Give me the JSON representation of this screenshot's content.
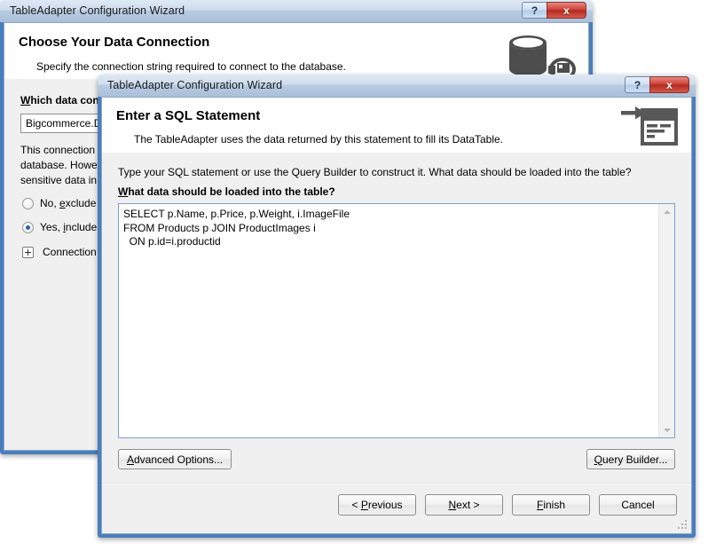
{
  "background_window": {
    "title": "TableAdapter Configuration Wizard",
    "help_button": "?",
    "close_button": "x",
    "heading": "Choose Your Data Connection",
    "subheading": "Specify the connection string required to connect to the database.",
    "icon": "database-icon",
    "connection_label_prefix": "W",
    "connection_label": "hich data conn",
    "connection_value": "Bigcommerce.D",
    "description_lines": [
      "This connection",
      "database. Howev",
      "sensitive data in"
    ],
    "radio_no": {
      "prefix": "No, ",
      "mnemonic": "e",
      "suffix": "xclude s",
      "checked": false
    },
    "radio_yes": {
      "prefix": "Yes, ",
      "mnemonic": "i",
      "suffix": "nclude s",
      "checked": true
    },
    "expander_label": "Connection",
    "expander_state": "+"
  },
  "foreground_window": {
    "title": "TableAdapter Configuration Wizard",
    "help_button": "?",
    "close_button": "x",
    "heading": "Enter a SQL Statement",
    "subheading": "The TableAdapter uses the data returned by this statement to fill its DataTable.",
    "icon": "sql-statement-icon",
    "instruction": "Type your SQL statement or use the Query Builder to construct it. What data should be loaded into the table?",
    "prompt_mnemonic": "W",
    "prompt_rest": "hat data should be loaded into the table?",
    "sql_value": "SELECT p.Name, p.Price, p.Weight, i.ImageFile\nFROM Products p JOIN ProductImages i\n  ON p.id=i.productid",
    "scrollbar": {
      "up_arrow": "scroll-up-icon",
      "down_arrow": "scroll-down-icon"
    },
    "advanced_options": {
      "mnemonic": "A",
      "rest": "dvanced Options..."
    },
    "query_builder": {
      "mnemonic": "Q",
      "rest": "uery Builder..."
    },
    "footer_buttons": [
      {
        "name": "previous",
        "prefix": "< ",
        "mnemonic": "P",
        "rest": "revious"
      },
      {
        "name": "next",
        "prefix": "",
        "mnemonic": "N",
        "rest": "ext >"
      },
      {
        "name": "finish",
        "prefix": "",
        "mnemonic": "F",
        "rest": "inish"
      },
      {
        "name": "cancel",
        "prefix": "",
        "mnemonic": "",
        "rest": "Cancel"
      }
    ]
  },
  "colors": {
    "frame_blue": "#4a7ebb",
    "close_red": "#cf4339",
    "dialog_gray": "#f0f0f0",
    "field_border_blue": "#7da2ce",
    "radio_dot": "#2c63a8"
  }
}
